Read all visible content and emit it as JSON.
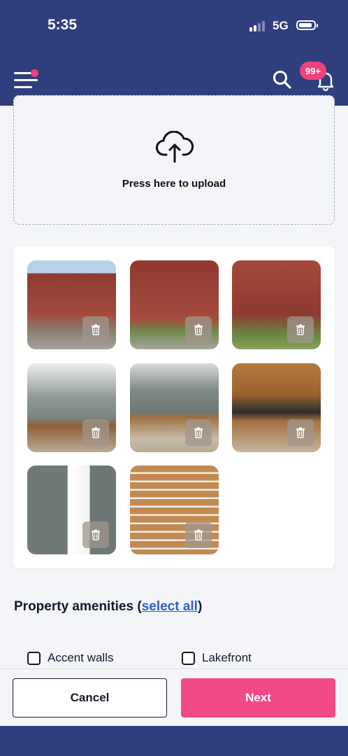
{
  "status_bar": {
    "time": "5:35",
    "network": "5G"
  },
  "header": {
    "notification_count": "99+"
  },
  "upload": {
    "label": "Press here to upload"
  },
  "gallery": {
    "photos": [
      {
        "name": "photo-exterior-1",
        "style": "brick"
      },
      {
        "name": "photo-exterior-entrance",
        "style": "brick2"
      },
      {
        "name": "photo-exterior-side",
        "style": "brick3"
      },
      {
        "name": "photo-kitchen-1",
        "style": "kitchen1"
      },
      {
        "name": "photo-living-kitchen",
        "style": "kitchen2"
      },
      {
        "name": "photo-kitchen-2",
        "style": "kitchen3"
      },
      {
        "name": "photo-door",
        "style": "door"
      },
      {
        "name": "photo-stairs",
        "style": "stairs"
      }
    ]
  },
  "amenities": {
    "title": "Property amenities",
    "open_paren": "(",
    "select_all": "select all",
    "close_paren": ")",
    "items": [
      {
        "label": "Accent walls",
        "checked": false
      },
      {
        "label": "Lakefront",
        "checked": false
      }
    ]
  },
  "footer": {
    "cancel_label": "Cancel",
    "next_label": "Next"
  },
  "colors": {
    "header": "#2f3e7d",
    "accent": "#f24a86",
    "link": "#2a5fd0"
  }
}
